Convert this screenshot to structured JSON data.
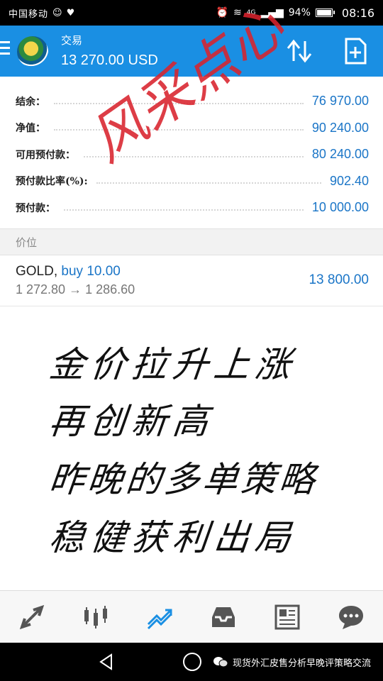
{
  "status_bar": {
    "carrier": "中国移动",
    "network": "4G",
    "battery": "94%",
    "time": "08:16"
  },
  "header": {
    "account_name": "交易",
    "balance": "13 270.00 USD"
  },
  "summary": [
    {
      "label": "结余：",
      "value": "76 970.00"
    },
    {
      "label": "净值：",
      "value": "90 240.00"
    },
    {
      "label": "可用预付款：",
      "value": "80 240.00"
    },
    {
      "label": "预付款比率(%):",
      "value": "902.40"
    },
    {
      "label": "预付款：",
      "value": "10 000.00"
    }
  ],
  "section_title": "价位",
  "position": {
    "symbol": "GOLD,",
    "side": "buy 10.00",
    "prices": "1 272.80 → 1 286.60",
    "profit": "13 800.00"
  },
  "calligraphy": [
    "金价拉升上涨",
    "再创新高",
    "昨晚的多单策略",
    "稳健获利出局"
  ],
  "stamp": "风采点心",
  "bottom_nav": [
    "quotes-icon",
    "chart-icon",
    "trade-icon",
    "history-icon",
    "news-icon",
    "chat-icon"
  ],
  "watermark": "现货外汇皮售分析早晚评策略交流",
  "colors": {
    "accent": "#1a8fe3",
    "value_blue": "#1a75c7",
    "stamp_red": "#d9232d"
  }
}
